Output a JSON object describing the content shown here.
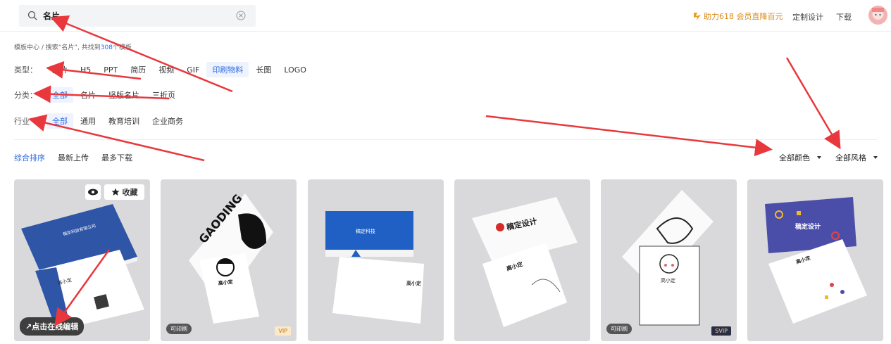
{
  "search": {
    "value": "名片",
    "placeholder": ""
  },
  "header": {
    "promo": "助力618 会员直降百元",
    "custom_design": "定制设计",
    "download": "下载"
  },
  "breadcrumb": {
    "prefix": "模板中心 / 搜索“名片”, 共找到",
    "count": "308",
    "suffix": "个模板"
  },
  "filters": {
    "type": {
      "label": "类型：",
      "options": [
        "图片",
        "H5",
        "PPT",
        "简历",
        "视频",
        "GIF",
        "印刷物料",
        "长图",
        "LOGO"
      ]
    },
    "category": {
      "label": "分类：",
      "options": [
        "全部",
        "名片",
        "竖版名片",
        "三折页"
      ]
    },
    "industry": {
      "label": "行业",
      "options": [
        "全部",
        "通用",
        "教育培训",
        "企业商务"
      ]
    }
  },
  "sort": {
    "options": [
      "综合排序",
      "最新上传",
      "最多下载"
    ]
  },
  "dropdowns": {
    "color": "全部颜色",
    "style": "全部风格"
  },
  "cards": [
    {
      "title_text": "稿定科技有限公司",
      "name": "高小定",
      "favorite": "收藏",
      "edit": "点击在线编辑"
    },
    {
      "brand": "GAODING",
      "name": "高小定",
      "badge_print": "可印刷",
      "badge_vip": "VIP"
    },
    {
      "brand": "稿定科技",
      "name": "高小定"
    },
    {
      "brand": "稿定设计",
      "name": "高小定"
    },
    {
      "name": "高小定",
      "badge_print": "可印刷",
      "badge_vip": "SVIP"
    },
    {
      "brand": "稿定设计",
      "name": "高小定"
    }
  ],
  "colors": {
    "accent": "#2e6be6",
    "promo": "#d98a1a",
    "arrow": "#e8383d"
  },
  "icons": [
    "search-icon",
    "clear-icon",
    "bolt-icon",
    "avatar",
    "eye-icon",
    "star-icon",
    "edit-arrow-icon",
    "caret-down-icon"
  ]
}
